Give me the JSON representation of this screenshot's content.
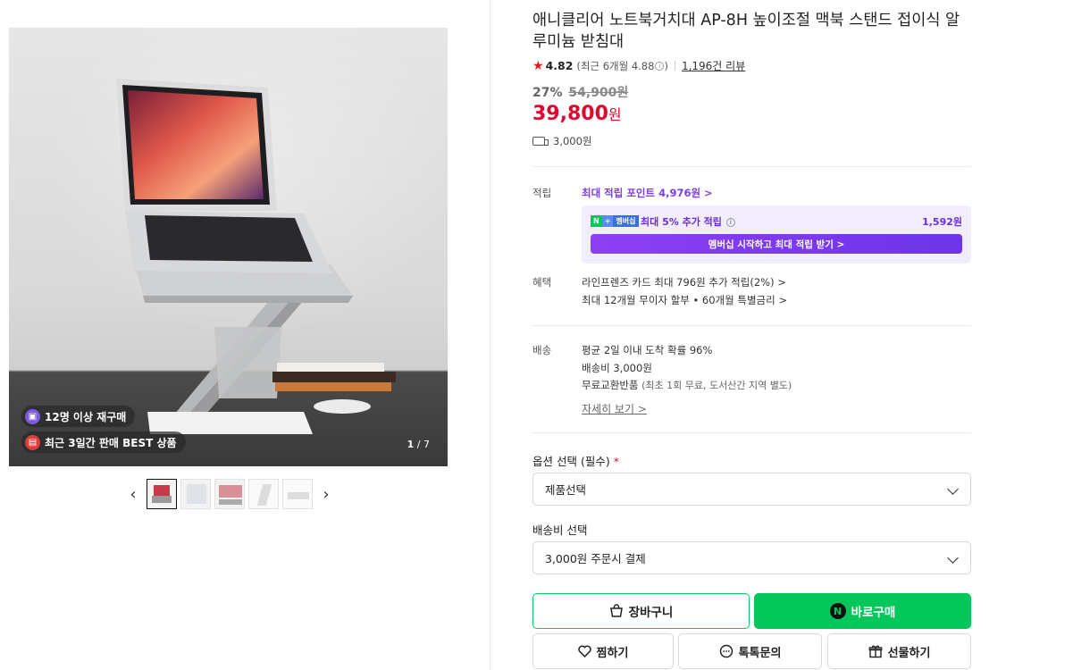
{
  "gallery": {
    "badge_repurchase": "12명 이상 재구매",
    "badge_best": "최근 3일간 판매 BEST 상품",
    "counter_current": "1",
    "counter_total": "7",
    "prev_icon": "chevron-left-icon",
    "next_icon": "chevron-right-icon",
    "thumbnail_count": 5
  },
  "product": {
    "title": "애니클리어 노트북거치대 AP-8H 높이조절 맥북 스탠드 접이식 알루미늄 받침대",
    "rating": "4.82",
    "rating_recent": "(최근 6개월 4.88",
    "rating_recent_close": ")",
    "review_count": "1,196건 리뷰",
    "discount_rate": "27%",
    "original_price": "54,900원",
    "price": "39,800",
    "price_unit": "원",
    "shipping_fee": "3,000원"
  },
  "points": {
    "label": "적립",
    "max_points_link": "최대 적립 포인트 4,976원 >",
    "membership_tag_n": "N",
    "membership_tag_plus": "+",
    "membership_tag_text": "멤버십",
    "membership_text": "최대 5% 추가 적립",
    "membership_amount": "1,592원",
    "membership_button": "멤버십 시작하고 최대 적립 받기 >"
  },
  "benefits": {
    "label": "혜택",
    "line1": "라인프렌즈 카드 최대 796원 추가 적립(2%) >",
    "line2": "최대 12개월 무이자 할부 • 60개월 특별금리 >"
  },
  "delivery": {
    "label": "배송",
    "line1": "평균 2일 이내 도착 확률 96%",
    "line2": "배송비 3,000원",
    "line3": "무료교환반품",
    "line3_note": "(최초 1회 무료, 도서산간 지역 별도)",
    "detail_link": "자세히 보기 >"
  },
  "options": {
    "option_label": "옵션 선택 (필수)",
    "option_required_mark": "*",
    "option_value": "제품선택",
    "shipping_label": "배송비 선택",
    "shipping_value": "3,000원 주문시 결제"
  },
  "actions": {
    "cart": "장바구니",
    "buy": "바로구매",
    "buy_icon_letter": "N",
    "wish": "찜하기",
    "talk": "톡톡문의",
    "gift": "선물하기"
  },
  "colors": {
    "price_red": "#e1062c",
    "naver_green": "#03c75a",
    "membership_purple": "#7a3dea"
  }
}
